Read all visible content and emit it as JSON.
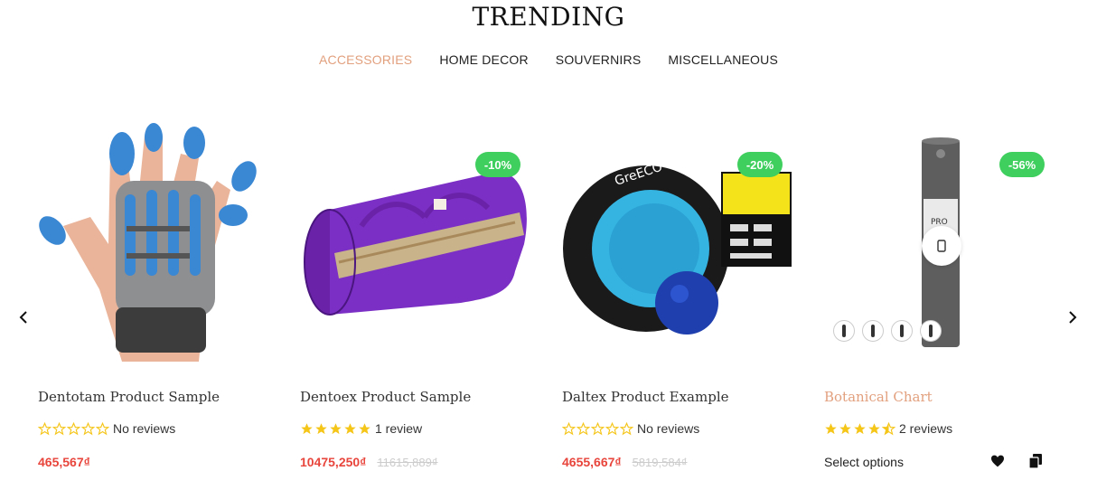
{
  "section": {
    "title": "TRENDING"
  },
  "tabs": [
    {
      "label": "ACCESSORIES",
      "active": true
    },
    {
      "label": "HOME DECOR",
      "active": false
    },
    {
      "label": "SOUVERNIRS",
      "active": false
    },
    {
      "label": "MISCELLANEOUS",
      "active": false
    }
  ],
  "colors": {
    "accent": "#e2a07e",
    "sale_badge": "#3fcf5e",
    "price": "#e8453c",
    "star": "#f5c518"
  },
  "products": [
    {
      "name": "Dentotam Product Sample",
      "rating": 0,
      "rating_text": "No reviews",
      "price": "465,567₫",
      "old_price": "",
      "badge": "",
      "image_icon": "hand-exerciser-image"
    },
    {
      "name": "Dentoex Product Sample",
      "rating": 5,
      "rating_text": "1 review",
      "price": "10475,250₫",
      "old_price": "11615,889₫",
      "badge": "-10%",
      "image_icon": "purple-bag-image"
    },
    {
      "name": "Daltex Product Example",
      "rating": 0,
      "rating_text": "No reviews",
      "price": "4655,667₫",
      "old_price": "5819,584₫",
      "badge": "-20%",
      "image_icon": "yoga-wheel-image"
    },
    {
      "name": "Botanical Chart",
      "rating": 4.5,
      "rating_text": "2 reviews",
      "select_label": "Select options",
      "badge": "-56%",
      "image_icon": "yoga-mat-image"
    }
  ]
}
